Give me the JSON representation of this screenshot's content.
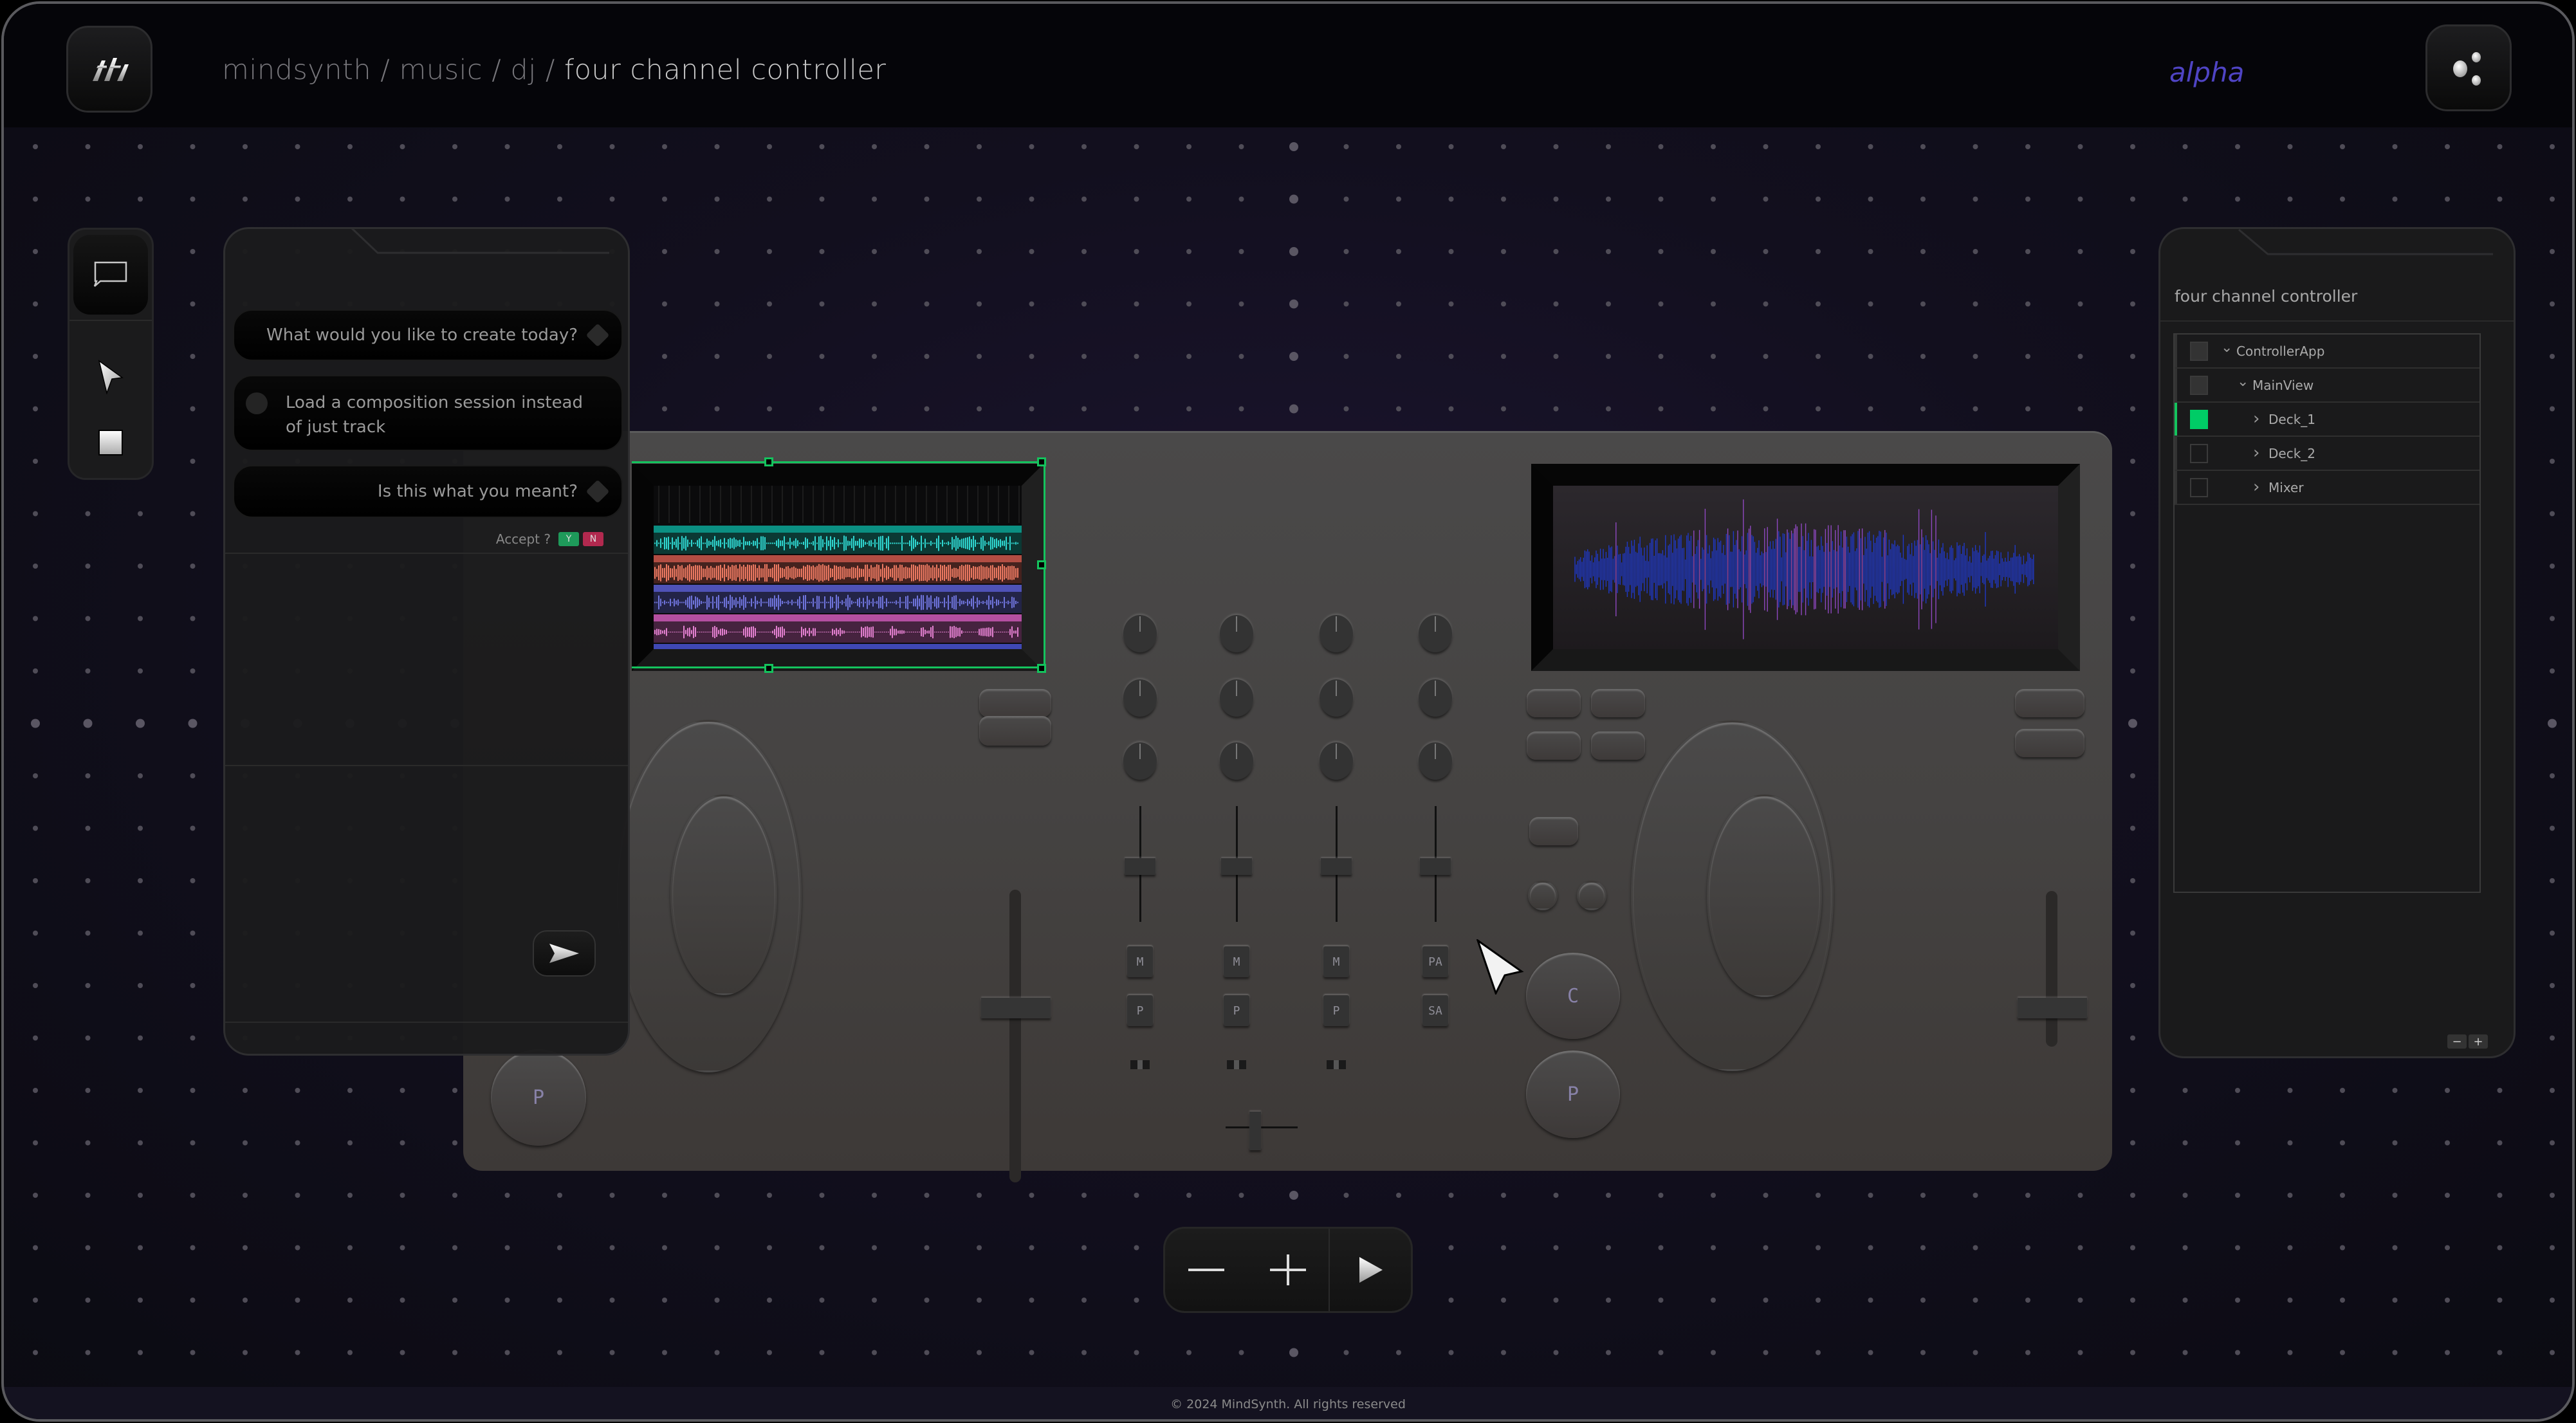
{
  "app": {
    "logo_icon": "mindsynth-logo-icon",
    "breadcrumb": [
      "mindsynth",
      "music",
      "dj",
      "four channel controller"
    ],
    "breadcrumb_separator": " / ",
    "channel_badge": "alpha",
    "settings_icon": "dots-cluster-icon"
  },
  "toolbar_left": {
    "tools": [
      {
        "name": "chat",
        "icon": "chat-bubble-icon",
        "active": true
      },
      {
        "name": "select",
        "icon": "pointer-arrow-icon",
        "active": false
      },
      {
        "name": "shape",
        "icon": "square-icon",
        "active": false
      }
    ]
  },
  "chat": {
    "messages": [
      {
        "role": "assistant",
        "text": "What would you like to create today?"
      },
      {
        "role": "user",
        "text": "Load a composition session instead of just  track"
      },
      {
        "role": "assistant",
        "text": "Is this what you meant?"
      }
    ],
    "accept_prompt": "Accept ?",
    "accept_yes": "Y",
    "accept_no": "N",
    "send_icon": "send-arrow-icon"
  },
  "controller": {
    "left_display": {
      "tracks": [
        {
          "color": "#0b8f82",
          "wave": "#2fd6d0"
        },
        {
          "color": "#b24d43",
          "wave": "#ee7a62"
        },
        {
          "color": "#4f52b6",
          "wave": "#6f74dc"
        },
        {
          "color": "#b44fa1",
          "wave": "#e380d0"
        },
        {
          "color": "#3f48b4",
          "wave": "#7a86e8"
        }
      ]
    },
    "right_display": {
      "wave_colors": [
        "#1f3bd8",
        "#9a4cd0"
      ]
    },
    "mixer": {
      "channels": 4,
      "knob_rows": 3,
      "fader_levels": [
        0.45,
        0.45,
        0.45,
        0.45
      ],
      "top_keys": [
        "M",
        "M",
        "M",
        "PA"
      ],
      "bottom_keys": [
        "P",
        "P",
        "P",
        "SA"
      ],
      "crossfader": 0.5
    },
    "left_deck": {
      "play_label": "P",
      "pitch_level": 0.5
    },
    "right_deck": {
      "cue_label": "C",
      "play_label": "P",
      "pitch_level": 0.5
    }
  },
  "inspector": {
    "title": "four channel controller",
    "tree": [
      {
        "label": "ControllerApp",
        "depth": 0,
        "expanded": true,
        "chevron": "chevron-down-icon",
        "swatch": "#333333",
        "selected": false
      },
      {
        "label": "MainView",
        "depth": 1,
        "expanded": true,
        "chevron": "chevron-down-icon",
        "swatch": "#333333",
        "selected": false
      },
      {
        "label": "Deck_1",
        "depth": 2,
        "expanded": false,
        "chevron": "chevron-right-icon",
        "swatch": "#00cc66",
        "selected": true
      },
      {
        "label": "Deck_2",
        "depth": 2,
        "expanded": false,
        "chevron": "chevron-right-icon",
        "swatch": "",
        "selected": false
      },
      {
        "label": "Mixer",
        "depth": 2,
        "expanded": false,
        "chevron": "chevron-right-icon",
        "swatch": "",
        "selected": false
      }
    ],
    "zoom_out": "−",
    "zoom_in": "+"
  },
  "bottom_toolbar": {
    "zoom_out_icon": "minus-icon",
    "zoom_in_icon": "plus-icon",
    "play_icon": "play-icon"
  },
  "footer": {
    "copyright": "© 2024 MindSynth. All rights reserved"
  },
  "colors": {
    "accent_green": "#14c35d",
    "accept_yes": "#1e9a5a",
    "accept_no": "#b2294f",
    "alpha_badge": "#4f44c4"
  }
}
